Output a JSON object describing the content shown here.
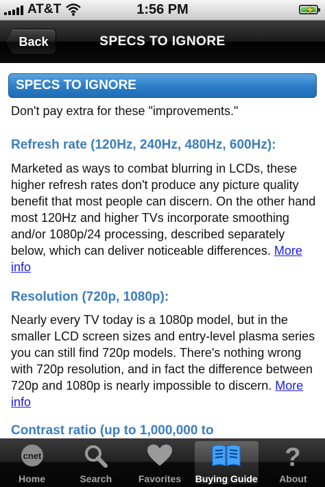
{
  "status": {
    "carrier": "AT&T",
    "time": "1:56 PM"
  },
  "nav": {
    "back_label": "Back",
    "title": "SPECS TO IGNORE"
  },
  "content": {
    "header": "SPECS TO IGNORE",
    "intro": "Don't pay extra for these \"improvements.\"",
    "sections": [
      {
        "heading": "Refresh rate (120Hz, 240Hz, 480Hz, 600Hz):",
        "body": "Marketed as ways to combat blurring in LCDs, these higher refresh rates don't produce any picture quality benefit that most people can discern. On the other hand most 120Hz and higher TVs incorporate smoothing and/or 1080p/24 processing, described separately below, which can deliver noticeable differences.",
        "link": "More info"
      },
      {
        "heading": "Resolution (720p, 1080p):",
        "body": "Nearly every TV today is a 1080p model, but in the smaller LCD screen sizes and entry-level plasma series you can still find 720p models. There's nothing wrong with 720p resolution, and in fact the difference between 720p and 1080p is nearly impossible to discern.",
        "link": "More info"
      },
      {
        "heading": "Contrast ratio (up to 1,000,000 to"
      }
    ]
  },
  "tabs": [
    {
      "label": "Home",
      "icon": "cnet-logo-icon"
    },
    {
      "label": "Search",
      "icon": "search-icon"
    },
    {
      "label": "Favorites",
      "icon": "heart-icon"
    },
    {
      "label": "Buying Guide",
      "icon": "book-icon",
      "active": true
    },
    {
      "label": "About",
      "icon": "question-icon"
    }
  ],
  "colors": {
    "heading_blue": "#3b7dbf",
    "header_blue": "#2b7cc6",
    "link_blue": "#1a1aee"
  }
}
